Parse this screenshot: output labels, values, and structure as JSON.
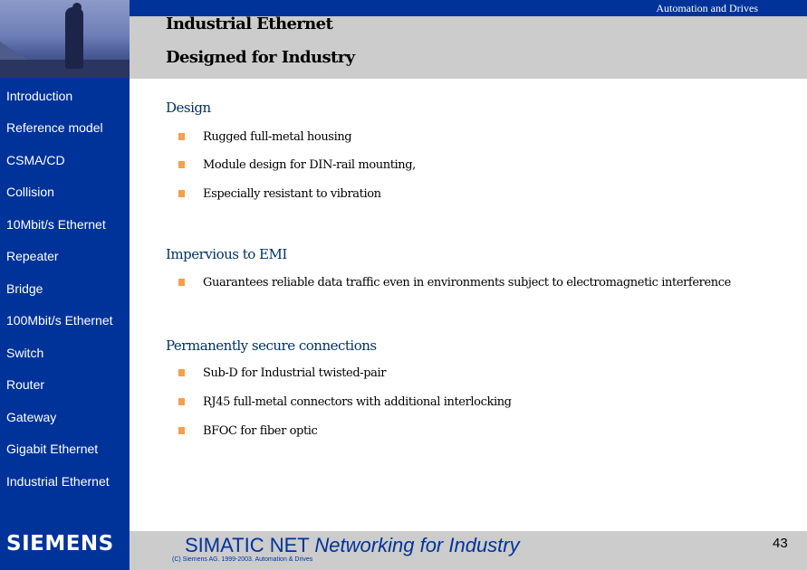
{
  "header": {
    "brand": "Automation and Drives",
    "title_line1": "Industrial Ethernet",
    "title_line2": "Designed for Industry"
  },
  "sidebar": {
    "items": [
      {
        "label": "Introduction"
      },
      {
        "label": "Reference model"
      },
      {
        "label": "CSMA/CD"
      },
      {
        "label": "Collision"
      },
      {
        "label": "10Mbit/s Ethernet"
      },
      {
        "label": "Repeater"
      },
      {
        "label": "Bridge"
      },
      {
        "label": "100Mbit/s Ethernet"
      },
      {
        "label": "Switch"
      },
      {
        "label": "Router"
      },
      {
        "label": "Gateway"
      },
      {
        "label": "Gigabit Ethernet"
      },
      {
        "label": "Industrial Ethernet"
      }
    ],
    "logo": "SIEMENS"
  },
  "content": {
    "sections": [
      {
        "heading": "Design",
        "bullets": [
          "Rugged full-metal housing",
          "Module design for DIN-rail mounting,",
          "Especially resistant to vibration"
        ]
      },
      {
        "heading": "Impervious to EMI",
        "bullets": [
          "Guarantees reliable data traffic even in environments subject to electromagnetic interference"
        ]
      },
      {
        "heading": "Permanently secure connections",
        "bullets": [
          "Sub-D for Industrial twisted-pair",
          "RJ45 full-metal connectors with additional interlocking",
          "BFOC for fiber optic"
        ]
      }
    ]
  },
  "footer": {
    "title_plain": "SIMATIC NET ",
    "title_italic": "Networking for Industry",
    "copyright": "(C) Siemens AG. 1999-2003. Automation & Drives",
    "page_number": "43"
  }
}
